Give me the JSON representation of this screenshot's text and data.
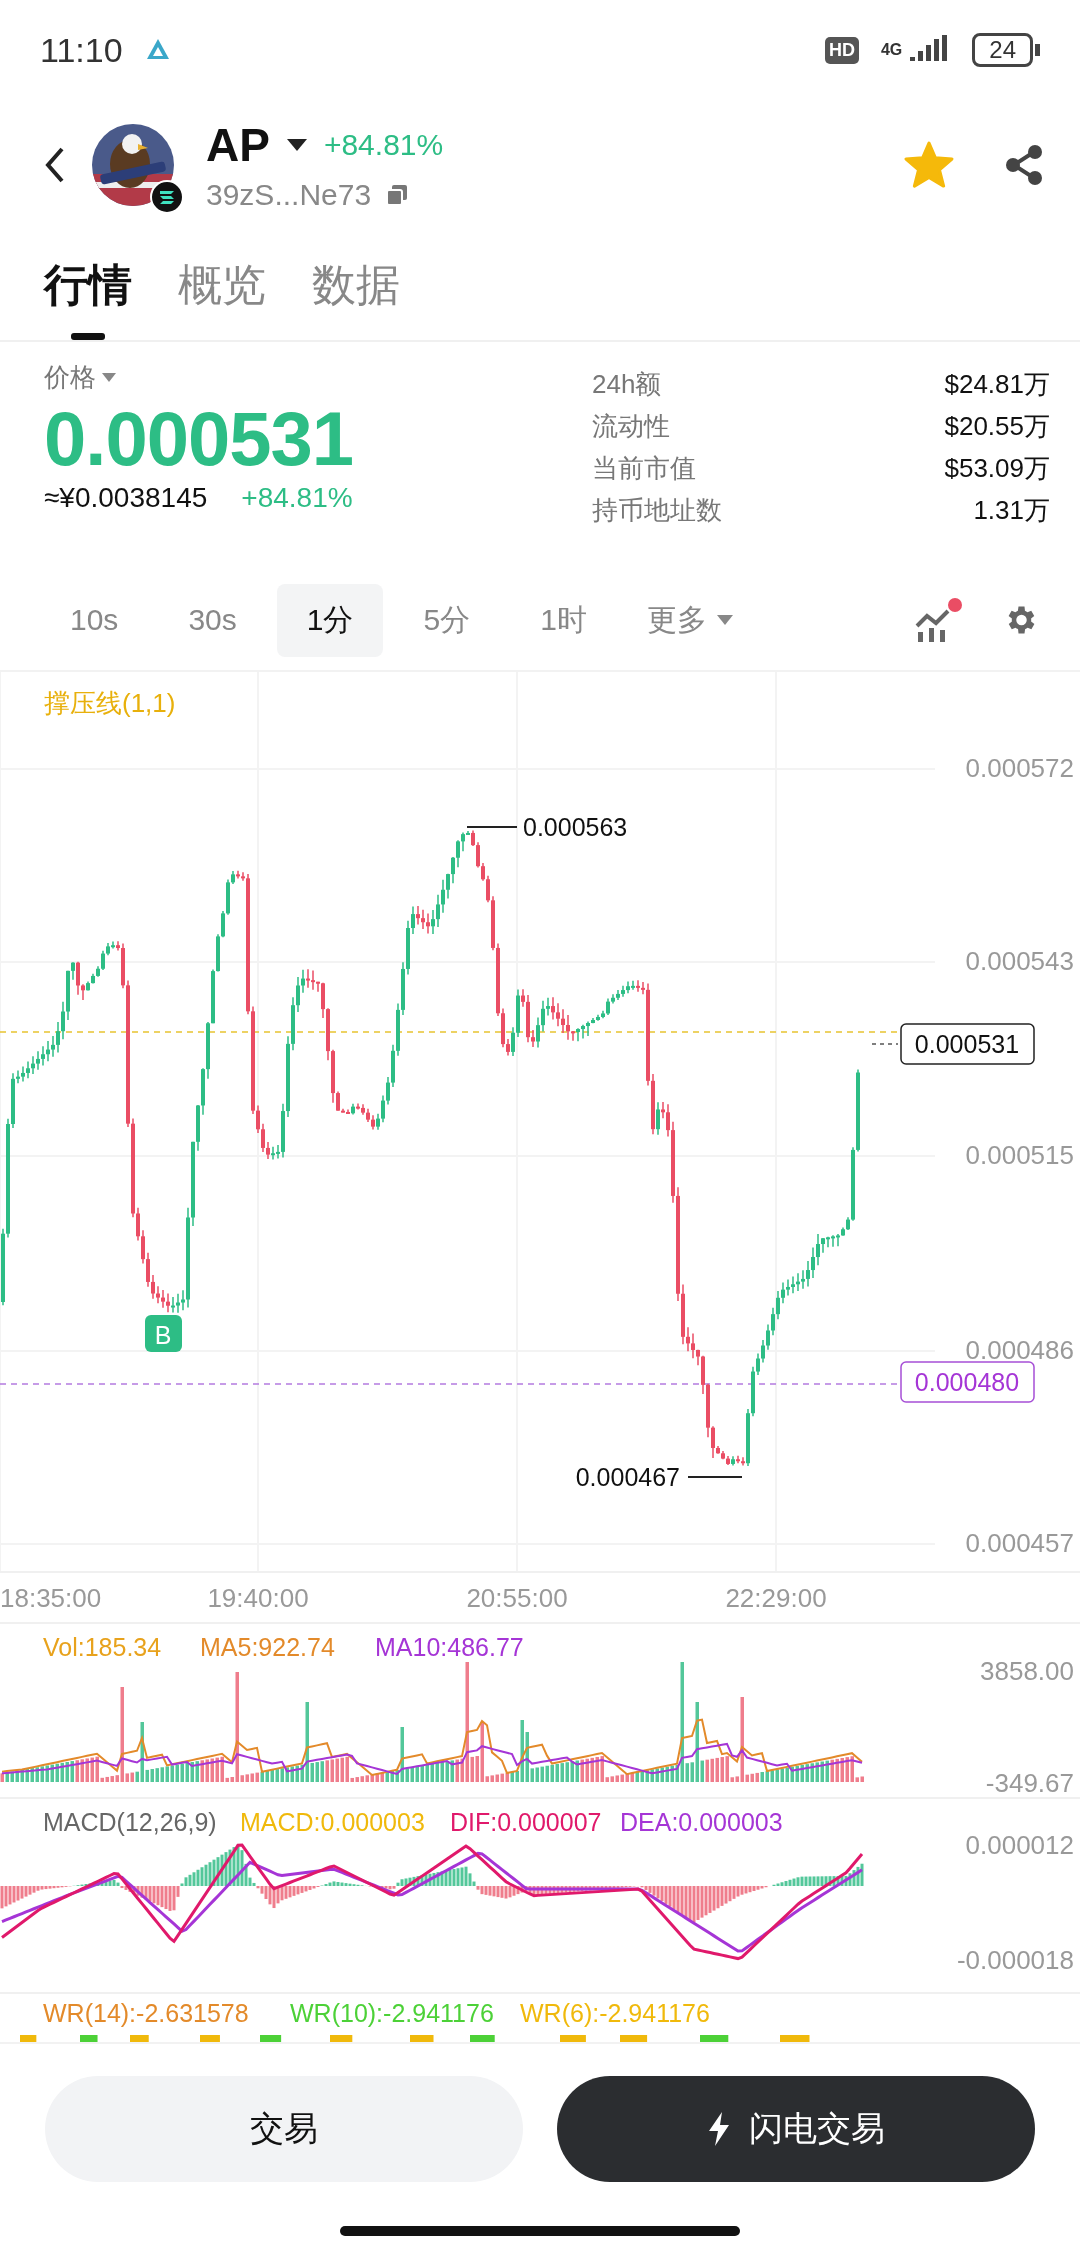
{
  "status_bar": {
    "time": "11:10",
    "hd": "HD",
    "network": "4G",
    "battery": "24"
  },
  "header": {
    "symbol": "AP",
    "change": "+84.81%",
    "address": "39zS...Ne73",
    "favorite": true
  },
  "tabs": [
    {
      "label": "行情",
      "selected": true
    },
    {
      "label": "概览",
      "selected": false
    },
    {
      "label": "数据",
      "selected": false
    }
  ],
  "price": {
    "label": "价格",
    "value": "0.000531",
    "cny": "≈¥0.0038145",
    "change": "+84.81%"
  },
  "stats": [
    {
      "label": "24h额",
      "value": "$24.81万"
    },
    {
      "label": "流动性",
      "value": "$20.55万"
    },
    {
      "label": "当前市值",
      "value": "$53.09万"
    },
    {
      "label": "持币地址数",
      "value": "1.31万"
    }
  ],
  "intervals": [
    {
      "label": "10s",
      "selected": false
    },
    {
      "label": "30s",
      "selected": false
    },
    {
      "label": "1分",
      "selected": true
    },
    {
      "label": "5分",
      "selected": false
    },
    {
      "label": "1时",
      "selected": false
    }
  ],
  "more": "更多",
  "indicator_alert": true,
  "chart": {
    "indicator": "撑压线(1,1)",
    "y_labels": [
      "0.000572",
      "0.000543",
      "0.000515",
      "0.000486",
      "0.000457"
    ],
    "high_label": "0.000563",
    "low_label": "0.000467",
    "current_price": "0.000531",
    "support_price": "0.000480",
    "buy_marker": "B",
    "x_labels": [
      "18:35:00",
      "19:40:00",
      "20:55:00",
      "22:29:00"
    ]
  },
  "volume": {
    "legend": [
      {
        "label": "Vol:185.34",
        "color": "#e8a21c"
      },
      {
        "label": "MA5:922.74",
        "color": "#e38a2a"
      },
      {
        "label": "MA10:486.77",
        "color": "#a535d6"
      }
    ],
    "y_max": "3858.00",
    "y_min": "-349.67"
  },
  "macd": {
    "title": "MACD(12,26,9)",
    "legend": [
      {
        "label": "MACD:0.000003",
        "color": "#f0b90b"
      },
      {
        "label": "DIF:0.000007",
        "color": "#e0196b"
      },
      {
        "label": "DEA:0.000003",
        "color": "#a535d6"
      }
    ],
    "y_max": "0.000012",
    "y_min": "-0.000018"
  },
  "wr": {
    "legend": [
      {
        "label": "WR(14):-2.631578",
        "color": "#e38a2a"
      },
      {
        "label": "WR(10):-2.941176",
        "color": "#4cd137"
      },
      {
        "label": "WR(6):-2.941176",
        "color": "#f0b90b"
      }
    ]
  },
  "buttons": [
    {
      "label": "交易",
      "kind": "secondary"
    },
    {
      "label": "闪电交易",
      "kind": "primary"
    }
  ]
}
